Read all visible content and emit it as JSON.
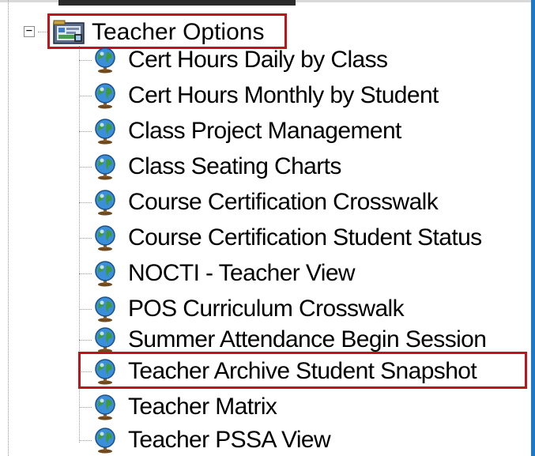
{
  "tree": {
    "root": {
      "label": "Teacher Options",
      "toggle_symbol": "−",
      "icon": "app-folder-icon",
      "highlighted": true
    },
    "items": [
      {
        "label": "Cert Hours Daily by Class",
        "icon": "globe-icon"
      },
      {
        "label": "Cert Hours Monthly by Student",
        "icon": "globe-icon"
      },
      {
        "label": "Class Project Management",
        "icon": "globe-icon"
      },
      {
        "label": "Class Seating Charts",
        "icon": "globe-icon"
      },
      {
        "label": "Course Certification Crosswalk",
        "icon": "globe-icon"
      },
      {
        "label": "Course Certification Student Status",
        "icon": "globe-icon"
      },
      {
        "label": "NOCTI - Teacher View",
        "icon": "globe-icon"
      },
      {
        "label": "POS Curriculum Crosswalk",
        "icon": "globe-icon"
      },
      {
        "label": "Summer Attendance Begin Session",
        "icon": "globe-icon"
      },
      {
        "label": "Teacher Archive Student Snapshot",
        "icon": "globe-icon",
        "highlighted": true
      },
      {
        "label": "Teacher Matrix",
        "icon": "globe-icon"
      },
      {
        "label": "Teacher PSSA View",
        "icon": "globe-icon"
      }
    ]
  },
  "colors": {
    "highlight": "#c0141c",
    "frame_accent": "#1a79c8",
    "text": "#000000"
  }
}
